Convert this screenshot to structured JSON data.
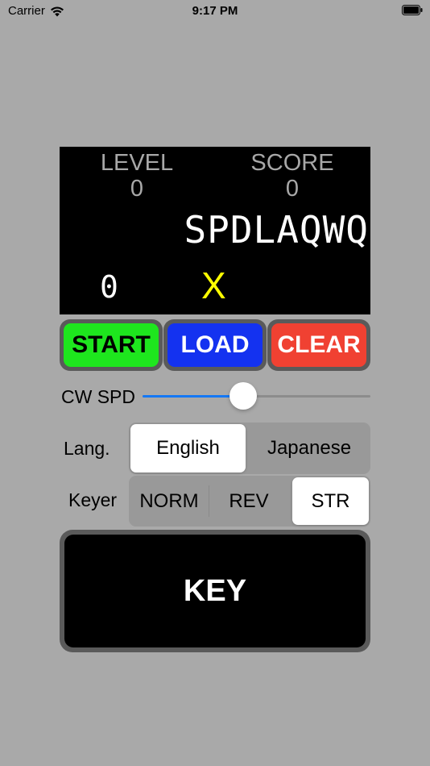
{
  "status_bar": {
    "carrier": "Carrier",
    "time": "9:17 PM",
    "wifi_icon": "wifi-icon",
    "battery_icon": "battery-icon"
  },
  "display": {
    "level_label": "LEVEL",
    "level_value": "0",
    "score_label": "SCORE",
    "score_value": "0",
    "code_text": "SPDLAQWQ",
    "count_text": "0",
    "mark_text": "X",
    "mark_color": "#ffff00"
  },
  "buttons": {
    "start": "START",
    "load": "LOAD",
    "clear": "CLEAR",
    "start_color": "#1ee61e",
    "load_color": "#1432f0",
    "clear_color": "#f04132"
  },
  "speed": {
    "label": "CW SPD",
    "slider_fraction": 0.44,
    "accent_color": "#1478f5"
  },
  "language": {
    "label": "Lang.",
    "options": [
      "English",
      "Japanese"
    ],
    "selected": "English"
  },
  "keyer": {
    "label": "Keyer",
    "options": [
      "NORM",
      "REV",
      "STR"
    ],
    "selected": "STR"
  },
  "key_button": {
    "label": "KEY"
  }
}
